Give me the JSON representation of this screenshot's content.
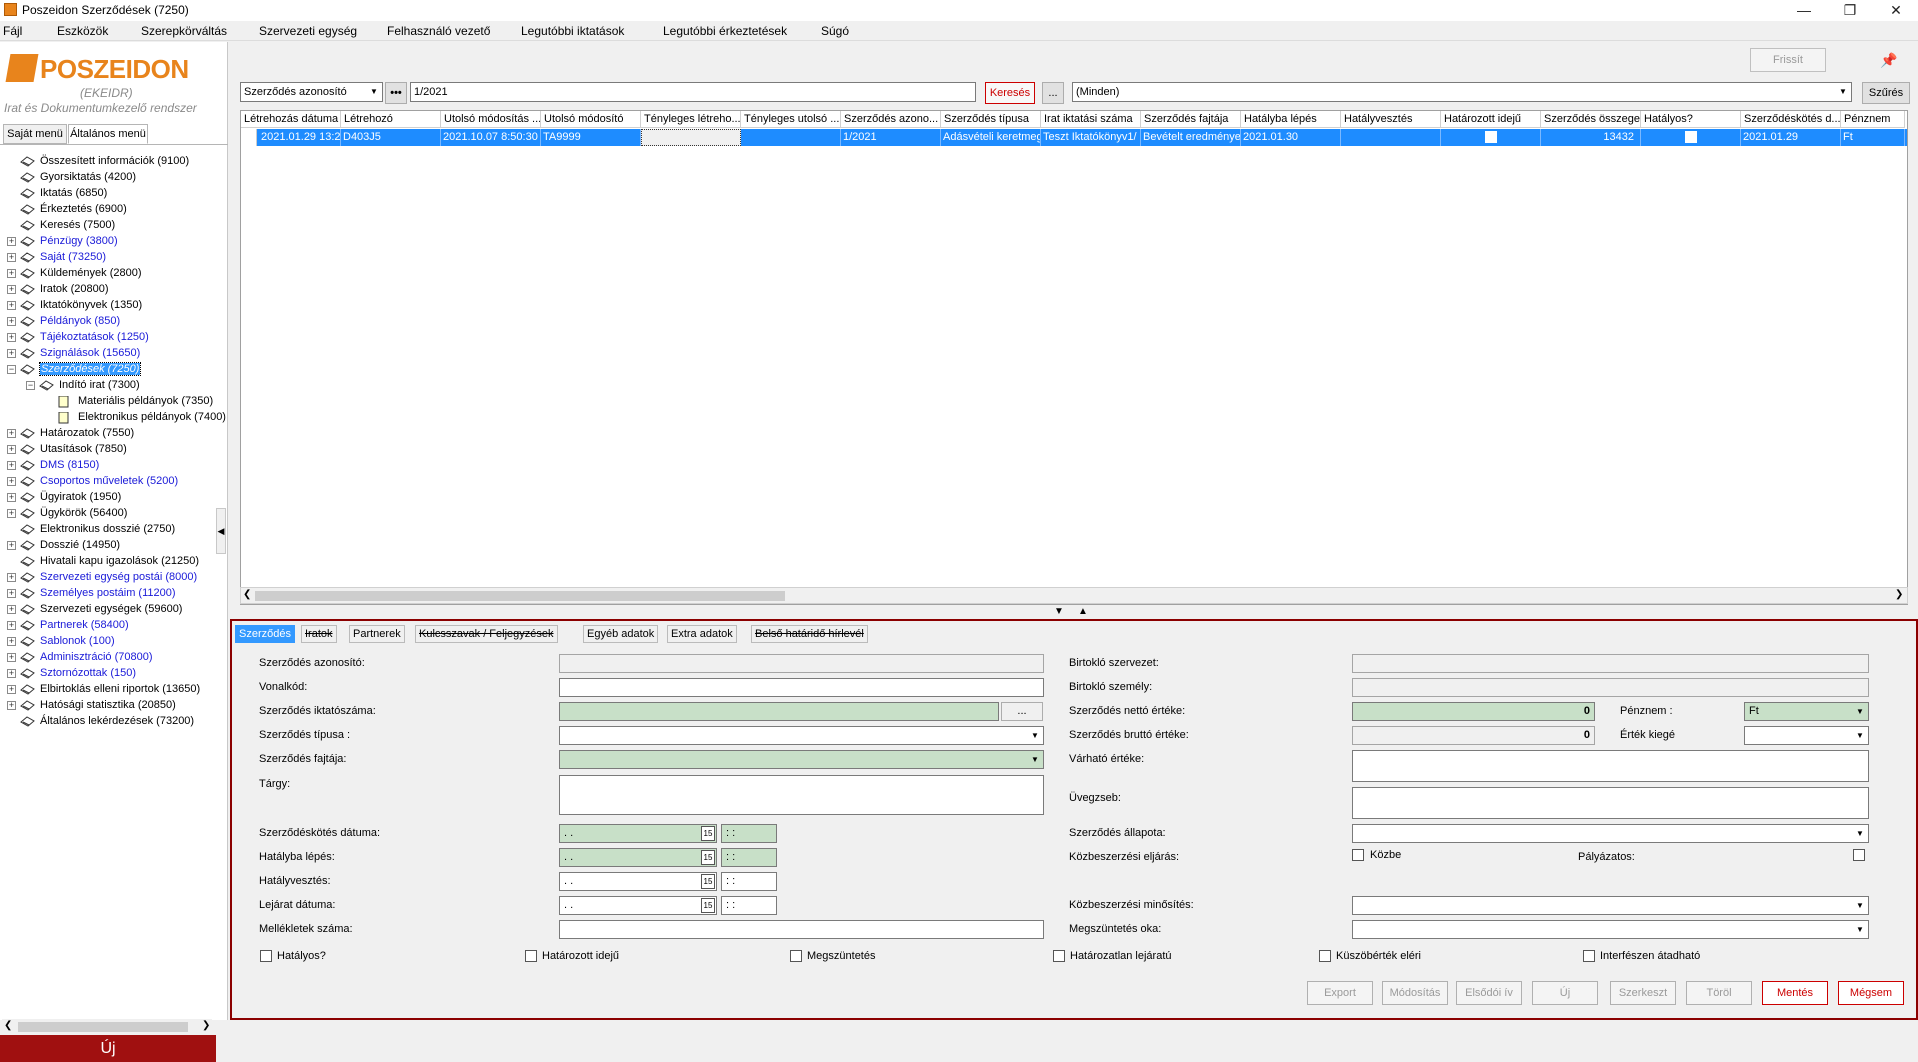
{
  "window": {
    "title": "Poszeidon Szerződések (7250)"
  },
  "menu": [
    "Fájl",
    "Eszközök",
    "Szerepkörváltás",
    "Szervezeti egység",
    "Felhasználó vezető",
    "Legutóbbi iktatások",
    "Legutóbbi érkeztetések",
    "Súgó"
  ],
  "logo": {
    "name": "POSZEIDON",
    "sub1": "(EKEIDR)",
    "sub2": "Irat és Dokumentumkezelő rendszer"
  },
  "sidebar": {
    "tabs": [
      "Saját menü",
      "Általános menü"
    ],
    "tree": [
      {
        "label": "Összesített információk (9100)",
        "blue": false,
        "exp": false
      },
      {
        "label": "Gyorsiktatás (4200)",
        "blue": false,
        "exp": false
      },
      {
        "label": "Iktatás (6850)",
        "blue": false,
        "exp": false
      },
      {
        "label": "Érkeztetés (6900)",
        "blue": false,
        "exp": false
      },
      {
        "label": "Keresés (7500)",
        "blue": false,
        "exp": false
      },
      {
        "label": "Pénzügy (3800)",
        "blue": true,
        "exp": true
      },
      {
        "label": "Saját (73250)",
        "blue": true,
        "exp": true
      },
      {
        "label": "Küldemények (2800)",
        "blue": false,
        "exp": true
      },
      {
        "label": "Iratok (20800)",
        "blue": false,
        "exp": true
      },
      {
        "label": "Iktatókönyvek (1350)",
        "blue": false,
        "exp": true
      },
      {
        "label": "Példányok (850)",
        "blue": true,
        "exp": true
      },
      {
        "label": "Tájékoztatások (1250)",
        "blue": true,
        "exp": true
      },
      {
        "label": "Szignálások (15650)",
        "blue": true,
        "exp": true
      },
      {
        "label": "Szerződések (7250)",
        "blue": true,
        "exp": true,
        "selected": true
      },
      {
        "label": "Indító irat (7300)",
        "blue": false,
        "exp": true,
        "level": 1
      },
      {
        "label": "Materiális példányok (7350)",
        "blue": false,
        "exp": false,
        "level": 2
      },
      {
        "label": "Elektronikus példányok (7400)",
        "blue": false,
        "exp": false,
        "level": 2
      },
      {
        "label": "Határozatok (7550)",
        "blue": false,
        "exp": true
      },
      {
        "label": "Utasítások (7850)",
        "blue": false,
        "exp": true
      },
      {
        "label": "DMS (8150)",
        "blue": true,
        "exp": true
      },
      {
        "label": "Csoportos műveletek (5200)",
        "blue": true,
        "exp": true
      },
      {
        "label": "Ügyiratok (1950)",
        "blue": false,
        "exp": true
      },
      {
        "label": "Ügykörök (56400)",
        "blue": false,
        "exp": true
      },
      {
        "label": "Elektronikus dosszié (2750)",
        "blue": false,
        "exp": false
      },
      {
        "label": "Dosszié (14950)",
        "blue": false,
        "exp": true
      },
      {
        "label": "Hivatali kapu igazolások (21250)",
        "blue": false,
        "exp": false
      },
      {
        "label": "Szervezeti egység postái (8000)",
        "blue": true,
        "exp": true
      },
      {
        "label": "Személyes postáim (11200)",
        "blue": true,
        "exp": true
      },
      {
        "label": "Szervezeti egységek (59600)",
        "blue": false,
        "exp": true
      },
      {
        "label": "Partnerek (58400)",
        "blue": true,
        "exp": true
      },
      {
        "label": "Sablonok (100)",
        "blue": true,
        "exp": true
      },
      {
        "label": "Adminisztráció (70800)",
        "blue": true,
        "exp": true
      },
      {
        "label": "Sztornózottak (150)",
        "blue": true,
        "exp": true
      },
      {
        "label": "Elbirtoklás elleni riportok (13650)",
        "blue": false,
        "exp": true
      },
      {
        "label": "Hatósági statisztika (20850)",
        "blue": false,
        "exp": true
      },
      {
        "label": "Általános lekérdezések (73200)",
        "blue": false,
        "exp": false
      }
    ],
    "new_button": "Új"
  },
  "toolbar": {
    "refresh": "Frissít",
    "search_field": "Szerződés azonosító",
    "search_value": "1/2021",
    "search_button": "Keresés",
    "more_button": "...",
    "filter_value": "(Minden)",
    "filter_button": "Szűrés"
  },
  "grid": {
    "columns": [
      "Létrehozás dátuma",
      "Létrehozó",
      "Utolsó módosítás ...",
      "Utolsó módosító",
      "Tényleges létreho...",
      "Tényleges utolsó ...",
      "Szerződés azono...",
      "Szerződés típusa",
      "Irat iktatási száma",
      "Szerződés fajtája",
      "Hatályba lépés",
      "Hatályvesztés",
      "Határozott idejű",
      "Szerződés összege",
      "Hatályos?",
      "Szerződéskötés d...",
      "Pénznem"
    ],
    "row": [
      "2021.01.29 13:2",
      "D403J5",
      "2021.10.07 8:50:30",
      "TA9999",
      "",
      "",
      "1/2021",
      "Adásvételi keretmeg",
      "Teszt Iktatókönyv1/",
      "Bevételt eredménye",
      "2021.01.30",
      "",
      "",
      "13432",
      "",
      "2021.01.29",
      "Ft"
    ]
  },
  "detail": {
    "tabs": [
      {
        "label": "Szerződés",
        "active": true,
        "struck": false
      },
      {
        "label": "Iratok",
        "active": false,
        "struck": true
      },
      {
        "label": "Partnerek",
        "active": false,
        "struck": false
      },
      {
        "label": "Kulcsszavak / Feljegyzések",
        "active": false,
        "struck": true
      },
      {
        "label": "Egyéb adatok",
        "active": false,
        "struck": false
      },
      {
        "label": "Extra adatok",
        "active": false,
        "struck": false
      },
      {
        "label": "Belső határidő hírlevél",
        "active": false,
        "struck": true
      }
    ],
    "labels": {
      "azonosito": "Szerződés azonosító:",
      "vonalkod": "Vonalkód:",
      "iktatoszam": "Szerződés iktatószáma:",
      "tipus": "Szerződés típusa :",
      "fajta": "Szerződés fajtája:",
      "targy": "Tárgy:",
      "kotes": "Szerződéskötés dátuma:",
      "hatalyba": "Hatályba lépés:",
      "hatalyvesztes": "Hatályvesztés:",
      "lejarat": "Lejárat dátuma:",
      "mellekletek": "Mellékletek száma:",
      "birtoklo_szerv": "Birtokló szervezet:",
      "birtoklo_szem": "Birtokló személy:",
      "netto": "Szerződés nettó értéke:",
      "penznem": "Pénznem :",
      "brutto": "Szerződés bruttó értéke:",
      "ertek_kieg": "Érték kiegé",
      "varhato": "Várható értéke:",
      "uvegzseb": "Üvegzseb:",
      "allapot": "Szerződés állapota:",
      "kozbeszerzesi": "Közbeszerzési eljárás:",
      "kozbe": "Közbe",
      "palyazatos": "Pályázatos:",
      "minosites": "Közbeszerzési minősítés:",
      "megszuntetes_oka": "Megszüntetés oka:"
    },
    "values": {
      "iktatoszam_btn": "...",
      "netto": "0",
      "brutto": "0",
      "penznem": "Ft",
      "date_placeholder": " .  .",
      "time_placeholder": " :  :"
    },
    "checkboxes": [
      "Hatályos?",
      "Határozott idejű",
      "Megszüntetés",
      "Határozatlan lejáratú",
      "Küszöbérték eléri",
      "Interfészen átadható"
    ]
  },
  "bottom_buttons": [
    "Export",
    "Módosítás",
    "Elsődói ív",
    "Új",
    "Szerkeszt",
    "Töröl",
    "Mentés",
    "Mégsem"
  ],
  "colors": {
    "accent": "#1e8cff",
    "brand": "#e8841c",
    "danger": "#a01010"
  }
}
